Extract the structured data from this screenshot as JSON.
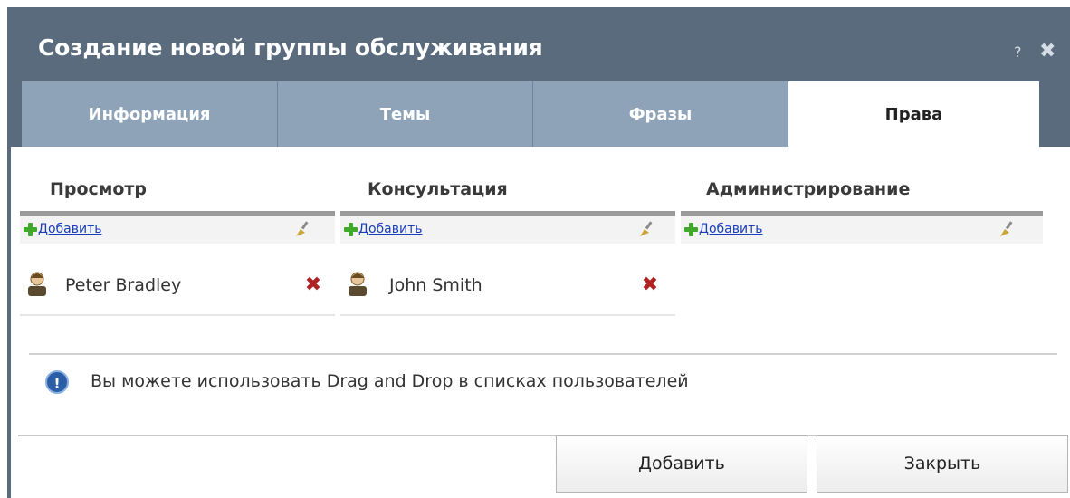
{
  "dialog": {
    "title": "Создание новой группы обслуживания",
    "help_glyph": "?",
    "close_glyph": "✖"
  },
  "tabs": [
    {
      "label": "Информация",
      "active": false
    },
    {
      "label": "Темы",
      "active": false
    },
    {
      "label": "Фразы",
      "active": false
    },
    {
      "label": "Права",
      "active": true
    }
  ],
  "columns": [
    {
      "title": "Просмотр",
      "add_label": "Добавить",
      "users": [
        "Peter Bradley"
      ]
    },
    {
      "title": "Консультация",
      "add_label": "Добавить",
      "users": [
        "John Smith"
      ]
    },
    {
      "title": "Администрирование",
      "add_label": "Добавить",
      "users": []
    }
  ],
  "info": {
    "icon": "info-icon",
    "text": "Вы можете использовать Drag and Drop в списках пользователей"
  },
  "buttons": {
    "add_label": "Добавить",
    "close_label": "Закрыть"
  },
  "colors": {
    "titlebar": "#5a6b7e",
    "tab": "#8fa3b8",
    "link": "#1a3eb8",
    "remove": "#b02323",
    "plus": "#3faa2a"
  }
}
